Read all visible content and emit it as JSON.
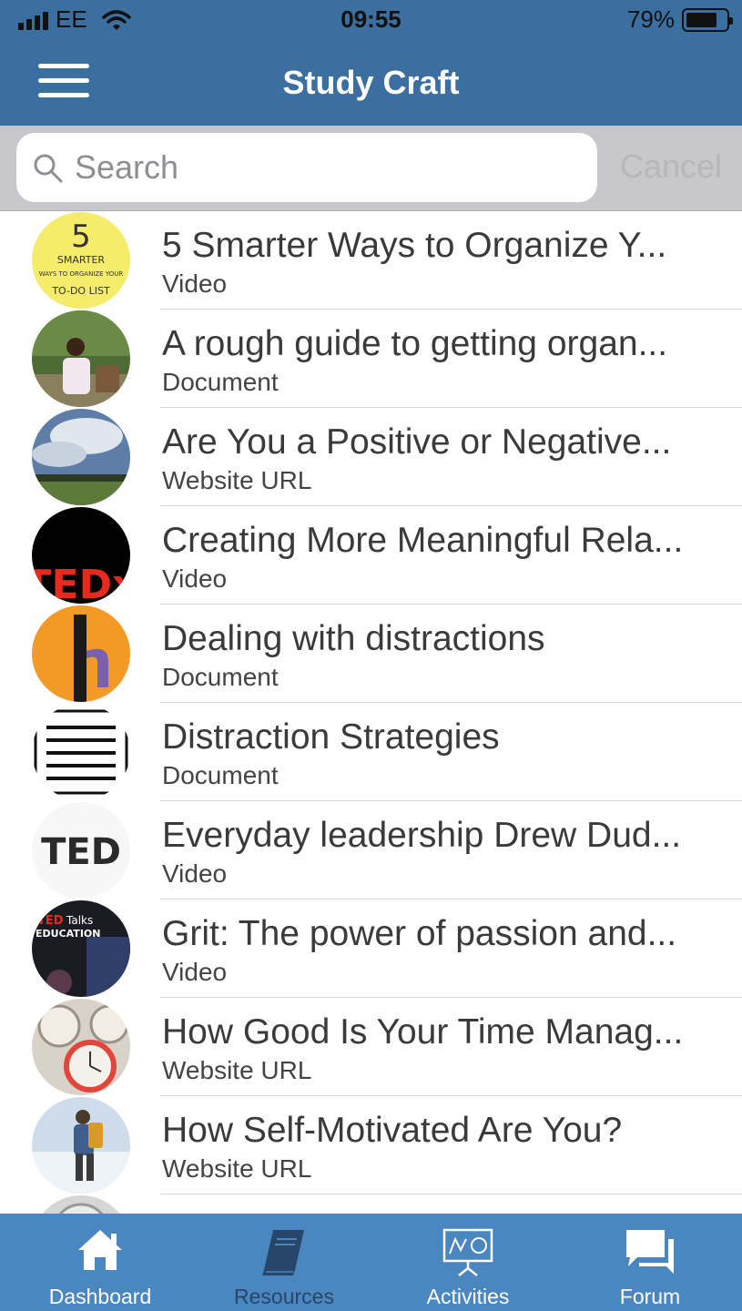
{
  "status_bar": {
    "carrier": "EE",
    "time": "09:55",
    "battery": "79%",
    "battery_level": 0.79
  },
  "nav": {
    "title": "Study Craft",
    "menu_icon": "hamburger-menu-icon"
  },
  "search": {
    "placeholder": "Search",
    "cancel_label": "Cancel",
    "icon": "search-icon"
  },
  "resources": [
    {
      "title": "5 Smarter Ways to Organize Y...",
      "type": "Video",
      "thumb": "to-do-list-note"
    },
    {
      "title": "A rough guide to getting organ...",
      "type": "Document",
      "thumb": "person-outdoors-photo"
    },
    {
      "title": "Are You a Positive or Negative...",
      "type": "Website URL",
      "thumb": "cloudy-sky-photo"
    },
    {
      "title": "Creating More Meaningful Rela...",
      "type": "Video",
      "thumb": "tedx-logo"
    },
    {
      "title": "Dealing with distractions",
      "type": "Document",
      "thumb": "orange-letter-h"
    },
    {
      "title": "Distraction Strategies",
      "type": "Document",
      "thumb": "document-lines-icon"
    },
    {
      "title": "Everyday leadership Drew Dud...",
      "type": "Video",
      "thumb": "ted-logo"
    },
    {
      "title": "Grit: The power of passion and...",
      "type": "Video",
      "thumb": "ted-talks-education-logo"
    },
    {
      "title": "How Good Is Your Time Manag...",
      "type": "Website URL",
      "thumb": "clocks-photo"
    },
    {
      "title": "How Self-Motivated Are You?",
      "type": "Website URL",
      "thumb": "hiker-in-snow-photo"
    },
    {
      "title": "",
      "type": "",
      "thumb": "snooze-clock-photo"
    }
  ],
  "tabs": [
    {
      "label": "Dashboard",
      "icon": "home-icon"
    },
    {
      "label": "Resources",
      "icon": "book-icon"
    },
    {
      "label": "Activities",
      "icon": "presentation-board-icon"
    },
    {
      "label": "Forum",
      "icon": "chat-bubbles-icon"
    }
  ],
  "colors": {
    "header_bg": "#3b6f9f",
    "tabbar_bg": "#4a86c0",
    "active_tab": "#27466a"
  }
}
